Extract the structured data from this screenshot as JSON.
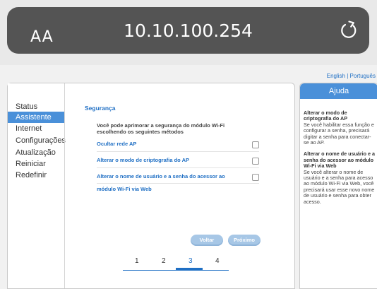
{
  "browser": {
    "text_size_label": "AA",
    "url": "10.10.100.254"
  },
  "language_links": "English | Português",
  "sidebar": {
    "items": [
      {
        "label": "Status",
        "active": false
      },
      {
        "label": "Assistente",
        "active": true
      },
      {
        "label": "Internet",
        "active": false
      },
      {
        "label": "Configurações",
        "active": false
      },
      {
        "label": "Atualização",
        "active": false
      },
      {
        "label": "Reiniciar",
        "active": false
      },
      {
        "label": "Redefinir",
        "active": false
      }
    ]
  },
  "main": {
    "title": "Segurança",
    "description": "Você pode aprimorar a segurança do módulo Wi-Fi escolhendo os seguintes métodos",
    "options": [
      {
        "label": "Ocultar rede AP",
        "checked": false
      },
      {
        "label": "Alterar o modo de criptografia do AP",
        "checked": false
      },
      {
        "label": "Alterar o nome de usuário e a senha do acessor ao",
        "label2": "módulo Wi-Fi via Web",
        "checked": false
      }
    ],
    "back_button": "Voltar",
    "next_button": "Próximo",
    "steps": [
      "1",
      "2",
      "3",
      "4"
    ],
    "current_step": "3"
  },
  "help": {
    "title": "Ajuda",
    "sections": [
      {
        "heading": "Alterar o modo de criptografia do AP",
        "text": "Se você habilitar essa função e configurar a senha, precisará digitar a senha para conectar-se ao AP."
      },
      {
        "heading": "Alterar o nome de usuário e a senha do acessor ao módulo Wi-Fi via Web",
        "text": "Se você alterar o nome de usuário e a senha para acesso ao módulo Wi-Fi via Web, você precisará usar esse novo nome de usuário e senha para obter acesso."
      }
    ]
  }
}
